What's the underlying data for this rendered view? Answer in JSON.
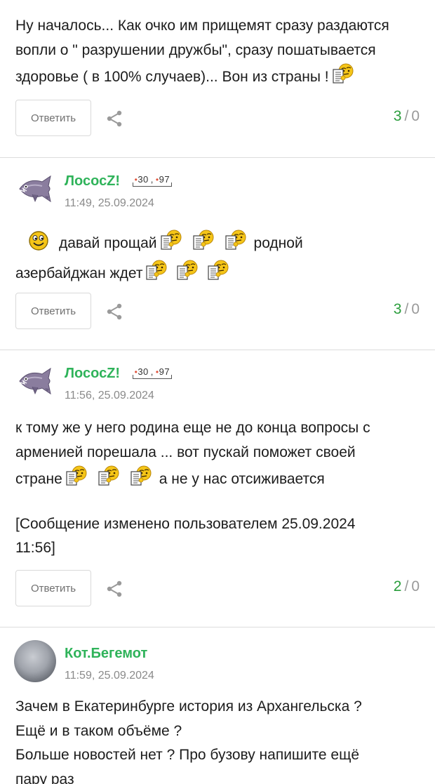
{
  "comment0": {
    "text_line1": "Ну началось... Как очко им прищемят сразу раздаются",
    "text_line2": "вопли о \" разрушении дружбы\", сразу пошатывается",
    "text_line3": "здоровье ( в 100% случаев)... Вон из страны !",
    "reply_label": "Ответить",
    "rating_plus": "3",
    "rating_sep": "/",
    "rating_minus": "0"
  },
  "comment1": {
    "author": "ЛососZ!",
    "badge_a": "30",
    "badge_b": "97",
    "time": "11:49, 25.09.2024",
    "text_a": "давай прощай",
    "text_b": "родной",
    "text_c": "азербайджан ждет",
    "reply_label": "Ответить",
    "rating_plus": "3",
    "rating_sep": "/",
    "rating_minus": "0"
  },
  "comment2": {
    "author": "ЛососZ!",
    "badge_a": "30",
    "badge_b": "97",
    "time": "11:56, 25.09.2024",
    "line1": "к тому же у него родина еще не до конца вопросы с",
    "line2": "арменией порешала ... вот пускай поможет своей",
    "line3a": "стране",
    "line3b": "а не у нас отсиживается",
    "edit_line1": "[Сообщение изменено пользователем 25.09.2024",
    "edit_line2": "11:56]",
    "reply_label": "Ответить",
    "rating_plus": "2",
    "rating_sep": "/",
    "rating_minus": "0"
  },
  "comment3": {
    "author": "Кот.Бегемот",
    "time": "11:59, 25.09.2024",
    "line1": "Зачем в Екатеринбурге история из Архангельска ?",
    "line2": "Ещё и в таком объёме ?",
    "line3": "Больше новостей нет ? Про бузову напишите ещё",
    "line4": "пару раз"
  },
  "icons": {
    "emoticon_thinking": "thinking-smiley-with-paper",
    "emoticon_smile": "smile",
    "share": "share-icon",
    "avatar_fish": "fish-avatar"
  },
  "colors": {
    "author": "#2fb35a",
    "rating_plus": "#2a9d3c",
    "muted": "#8a8a8a",
    "divider": "#dcdcdc"
  }
}
